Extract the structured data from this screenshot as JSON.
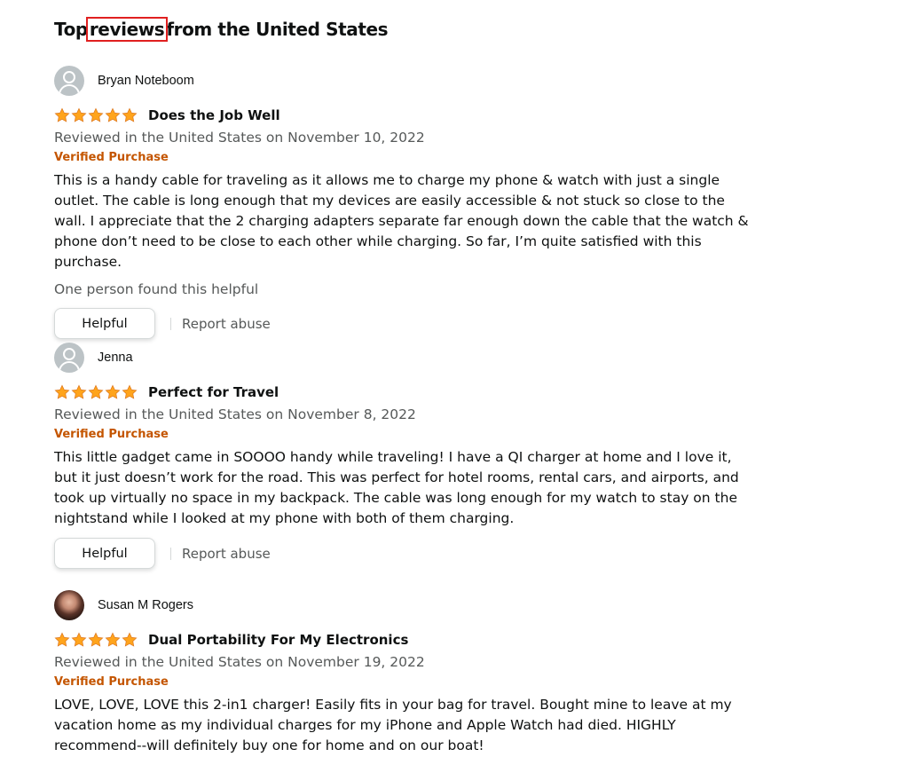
{
  "header": {
    "title_prefix": "Top",
    "title_highlight": "reviews",
    "title_suffix": "from the United States"
  },
  "colors": {
    "star": "#ffa41c",
    "star_outline": "#de7921",
    "verified": "#c45500",
    "muted_text": "#565959",
    "highlight_box": "#e02020"
  },
  "reviews": [
    {
      "author": "Bryan Noteboom",
      "avatar_icon": "default-user-icon",
      "rating": 5,
      "title": "Does the Job Well",
      "date": "Reviewed in the United States on November 10, 2022",
      "verified": "Verified Purchase",
      "body": "This is a handy cable for traveling as it allows me to charge my phone & watch with just a single outlet. The cable is long enough that my devices are easily accessible & not stuck so close to the wall. I appreciate that the 2 charging adapters separate far enough down the cable that the watch & phone don’t need to be close to each other while charging. So far, I’m quite satisfied with this purchase.",
      "helpful_count": "One person found this helpful",
      "helpful_label": "Helpful",
      "report_label": "Report abuse"
    },
    {
      "author": "Jenna",
      "avatar_icon": "default-user-icon",
      "rating": 5,
      "title": "Perfect for Travel",
      "date": "Reviewed in the United States on November 8, 2022",
      "verified": "Verified Purchase",
      "body": "This little gadget came in SOOOO handy while traveling! I have a QI charger at home and I love it, but it just doesn’t work for the road. This was perfect for hotel rooms, rental cars, and airports, and took up virtually no space in my backpack. The cable was long enough for my watch to stay on the nightstand while I looked at my phone with both of them charging.",
      "helpful_label": "Helpful",
      "report_label": "Report abuse"
    },
    {
      "author": "Susan M Rogers",
      "avatar_icon": "profile-photo",
      "rating": 5,
      "title": "Dual Portability For My Electronics",
      "date": "Reviewed in the United States on November 19, 2022",
      "verified": "Verified Purchase",
      "body": "LOVE, LOVE, LOVE this 2-in1 charger! Easily fits in your bag for travel. Bought mine to leave at my vacation home as my individual charges for my iPhone and Apple Watch had died. HIGHLY recommend--will definitely buy one for home and on our boat!"
    }
  ]
}
